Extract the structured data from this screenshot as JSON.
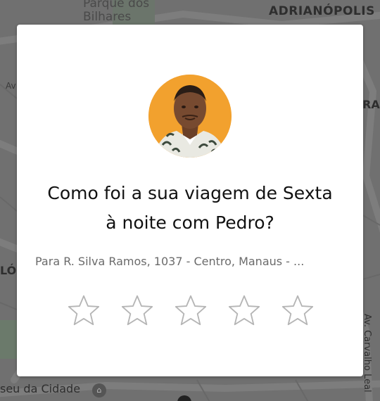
{
  "map": {
    "labels": {
      "parque": "Parque dos\nBilhares",
      "adrianopolis": "ADRIANÓPOLIS",
      "ra": "RA",
      "av": "Av",
      "lo": "LÓ",
      "museu": "seu da Cidade",
      "carvalho": "Av. Carvalho Leal"
    },
    "icons": [
      "museum-icon",
      "location-dot-icon"
    ]
  },
  "rating_card": {
    "driver_name": "Pedro",
    "question_line1": "Como foi a sua viagem de Sexta",
    "question_line2": "à noite com Pedro?",
    "destination": "Para R. Silva Ramos, 1037 - Centro, Manaus - ...",
    "star_count": 5,
    "selected_rating": 0,
    "colors": {
      "avatar_bg": "#f2a12e",
      "star_outline": "#b5b5b5",
      "text_primary": "#111111",
      "text_secondary": "#6b6b6b"
    },
    "stars": [
      {
        "label": "1 star",
        "icon": "star-outline-icon"
      },
      {
        "label": "2 stars",
        "icon": "star-outline-icon"
      },
      {
        "label": "3 stars",
        "icon": "star-outline-icon"
      },
      {
        "label": "4 stars",
        "icon": "star-outline-icon"
      },
      {
        "label": "5 stars",
        "icon": "star-outline-icon"
      }
    ]
  }
}
